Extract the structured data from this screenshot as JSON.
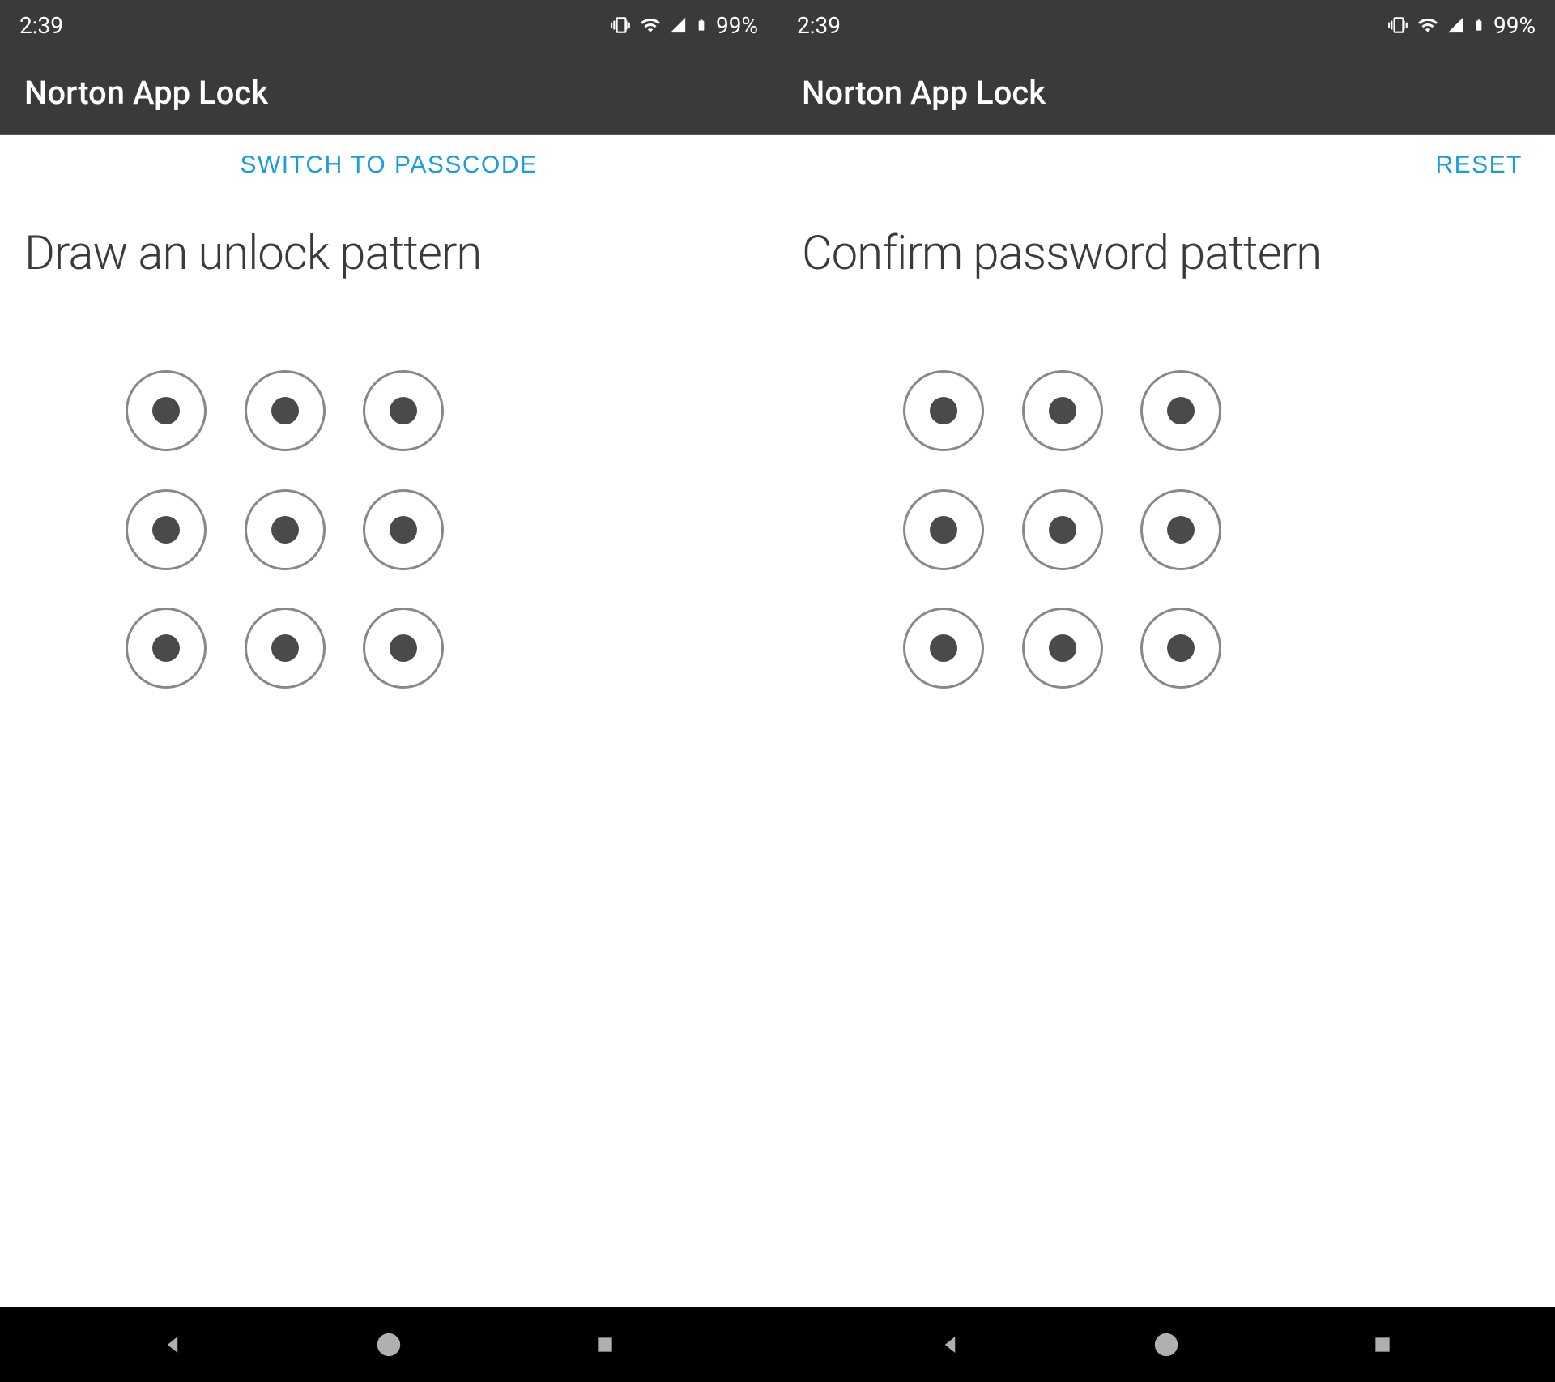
{
  "status_bar": {
    "time": "2:39",
    "battery": "99%"
  },
  "screens": {
    "left": {
      "app_title": "Norton App Lock",
      "action_label": "SWITCH TO PASSCODE",
      "heading": "Draw an unlock pattern"
    },
    "right": {
      "app_title": "Norton App Lock",
      "action_label": "RESET",
      "heading": "Confirm password pattern"
    }
  }
}
